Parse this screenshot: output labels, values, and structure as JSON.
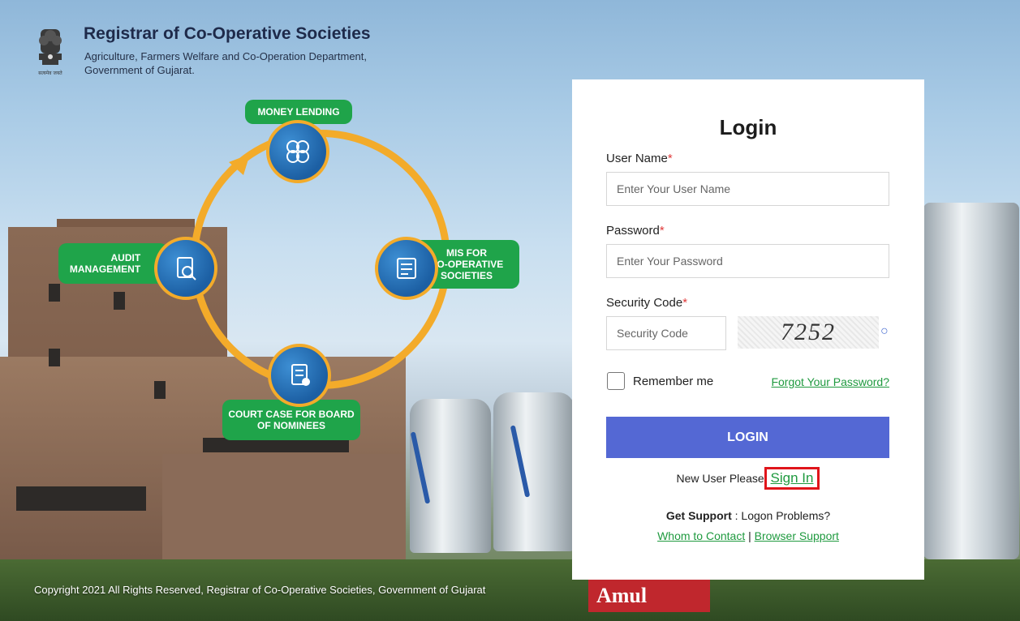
{
  "header": {
    "title": "Registrar of Co-Operative Societies",
    "subtitle_line1": "Agriculture, Farmers Welfare and Co-Operation Department,",
    "subtitle_line2": "Government of Gujarat.",
    "emblem_caption": "सत्यमेव जयते"
  },
  "diagram": {
    "money_lending": "MONEY LENDING",
    "mis_line1": "MIS FOR",
    "mis_line2": "CO-OPERATIVE",
    "mis_line3": "SOCIETIES",
    "audit_line1": "AUDIT",
    "audit_line2": "MANAGEMENT",
    "court_line1": "COURT CASE FOR BOARD",
    "court_line2": "OF NOMINEES"
  },
  "login": {
    "title": "Login",
    "username_label": "User Name",
    "username_placeholder": "Enter Your User Name",
    "password_label": "Password",
    "password_placeholder": "Enter Your Password",
    "security_label": "Security Code",
    "security_placeholder": "Security Code",
    "captcha_text": "7252",
    "required_mark": "*",
    "remember_label": "Remember me",
    "forgot_link": "Forgot Your Password?",
    "login_button": "LOGIN",
    "new_user_text": "New User Please",
    "sign_in_link": "Sign In",
    "support_label": "Get Support",
    "support_text": " : Logon Problems?",
    "whom_to_contact": "Whom to Contact",
    "link_separator": " | ",
    "browser_support": "Browser Support"
  },
  "background": {
    "amul_sign": "Amul"
  },
  "footer": {
    "copyright": "Copyright 2021 All Rights Reserved, Registrar of Co-Operative Societies, Government of Gujarat"
  },
  "colors": {
    "accent_button": "#5468d4",
    "link_green": "#1f9a3f",
    "tag_green": "#1fa44a",
    "ring_orange": "#f3ab2a",
    "highlight_red": "#e0151b"
  }
}
